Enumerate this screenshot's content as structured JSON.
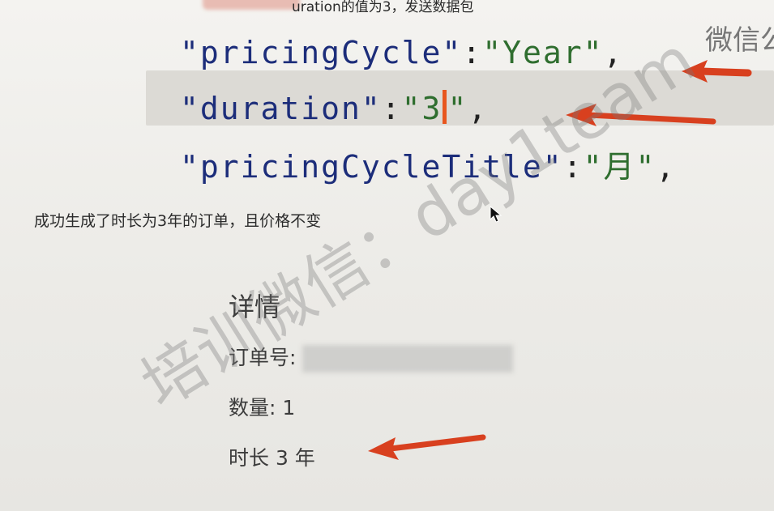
{
  "header": {
    "caption": "uration的值为3，发送数据包"
  },
  "code": {
    "line1": {
      "key": "\"pricingCycle\"",
      "sep": ":",
      "value": "\"Year\"",
      "end": ","
    },
    "line2": {
      "key": "\"duration\"",
      "sep": ":",
      "value_open": "\"3",
      "value_close": "\"",
      "end": ","
    },
    "line3": {
      "key": "\"pricingCycleTitle\"",
      "sep": ":",
      "value": "\"月\"",
      "end": ","
    }
  },
  "side_text": "微信公",
  "body": {
    "message": "成功生成了时长为3年的订单，且价格不变"
  },
  "details": {
    "title": "详情",
    "order_label": "订单号:",
    "quantity_label": "数量: 1",
    "duration_label": "时长 3 年"
  },
  "watermark": "培训微信：day1team",
  "colors": {
    "key": "#1c2d7a",
    "value": "#2f6e2f",
    "arrow": "#d8401f",
    "caret": "#e8561e"
  }
}
